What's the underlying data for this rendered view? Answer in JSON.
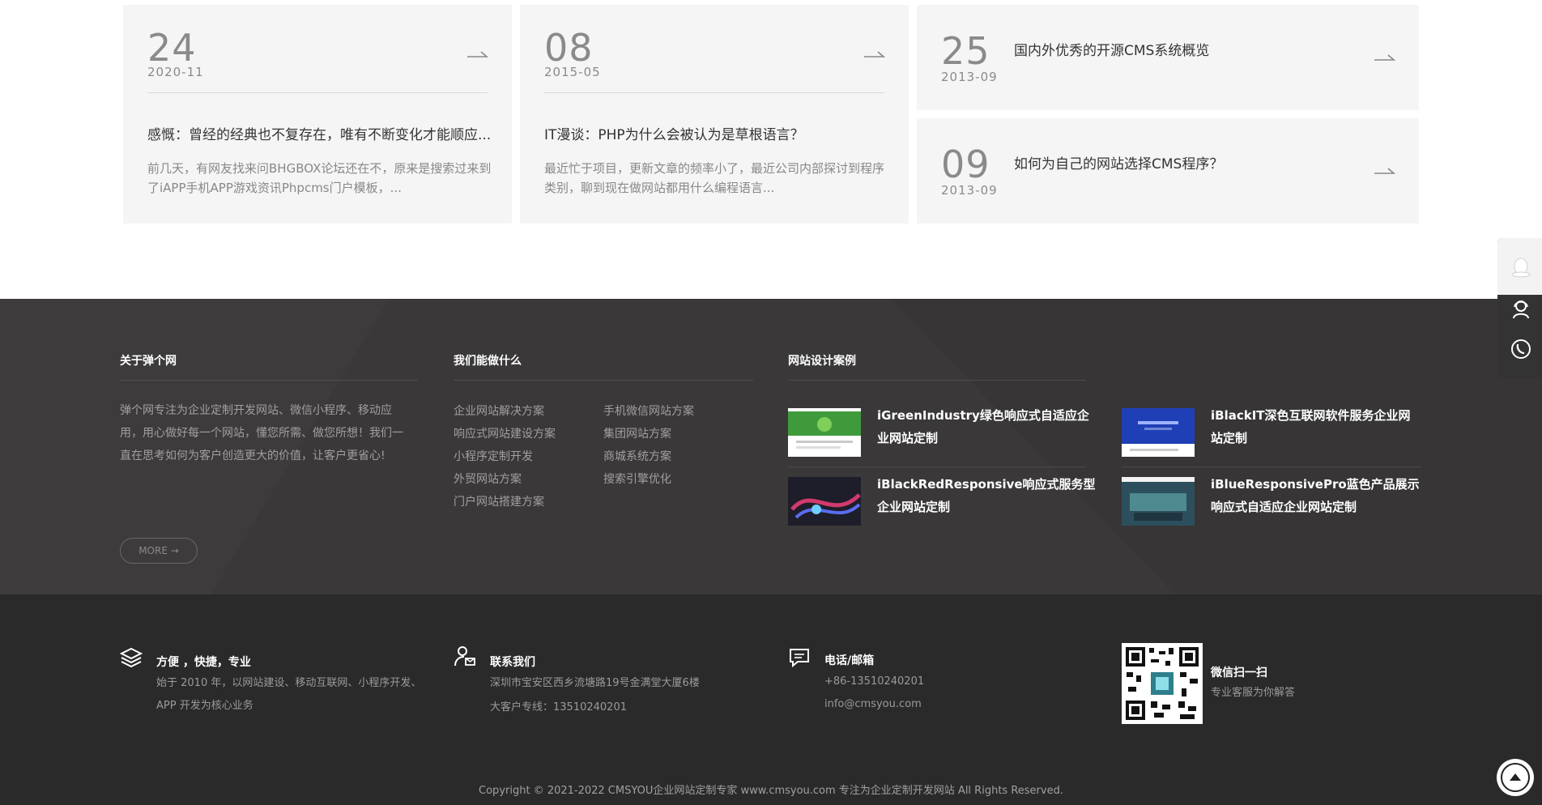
{
  "news": {
    "cards": [
      {
        "day": "24",
        "ym": "2020-11",
        "title": "感慨：曾经的经典也不复存在，唯有不断变化才能顺应...",
        "desc": "前几天，有网友找来问BHGBOX论坛还在不，原来是搜索过来到了iAPP手机APP游戏资讯Phpcms门户模板，..."
      },
      {
        "day": "08",
        "ym": "2015-05",
        "title": "IT漫谈：PHP为什么会被认为是草根语言？",
        "desc": "最近忙于项目，更新文章的频率小了，最近公司内部探讨到程序类别，聊到现在做网站都用什么编程语言..."
      }
    ],
    "side_items": [
      {
        "day": "25",
        "ym": "2013-09",
        "title": "国内外优秀的开源CMS系统概览"
      },
      {
        "day": "09",
        "ym": "2013-09",
        "title": "如何为自己的网站选择CMS程序？"
      }
    ]
  },
  "footer": {
    "about": {
      "heading": "关于弹个网",
      "text": "弹个网专注为企业定制开发网站、微信小程序、移动应用，用心做好每一个网站，懂您所需、做您所想！我们一直在思考如何为客户创造更大的价值，让客户更省心!",
      "more": "MORE →"
    },
    "services": {
      "heading": "我们能做什么",
      "col1": [
        "企业网站解决方案",
        "响应式网站建设方案",
        "小程序定制开发",
        "外贸网站方案",
        "门户网站搭建方案"
      ],
      "col2": [
        "手机微信网站方案",
        "集团网站方案",
        "商城系统方案",
        "搜索引擎优化"
      ]
    },
    "cases": {
      "heading": "网站设计案例",
      "items": [
        {
          "title": "iGreenIndustry绿色响应式自适应企业网站定制"
        },
        {
          "title": "iBlackIT深色互联网软件服务企业网站定制"
        },
        {
          "title": "iBlackRedResponsive响应式服务型企业网站定制"
        },
        {
          "title": "iBlueResponsivePro蓝色产品展示响应式自适应企业网站定制"
        }
      ]
    },
    "features": {
      "title": "方便 ，快捷，专业",
      "line1": "始于 2010 年，以网站建设、移动互联网、小程序开发、",
      "line2": "APP 开发为核心业务"
    },
    "contact": {
      "title": "联系我们",
      "address": "深圳市宝安区西乡流塘路19号金满堂大厦6楼",
      "hotline": "大客户专线：13510240201"
    },
    "phone": {
      "title": "电话/邮箱",
      "phone": "+86-13510240201",
      "email": "info@cmsyou.com"
    },
    "wechat": {
      "title": "微信扫一扫",
      "subtitle": "专业客服为你解答"
    },
    "copyright": "Copyright © 2021-2022 CMSYOU企业网站定制专家 www.cmsyou.com 专注为企业定制开发网站 All Rights Reserved."
  },
  "icons": {
    "arrow": "arrow-right-icon",
    "layers": "layers-icon",
    "contact": "user-mail-icon",
    "chat": "chat-icon",
    "qq": "qq-icon",
    "support": "customer-service-icon",
    "phone": "phone-icon",
    "top": "back-to-top-icon"
  },
  "colors": {
    "card_bg": "#f5f5f5",
    "footer_top_bg": "#3a3838",
    "footer_bottom_bg": "#2b2a2a",
    "muted_text": "#a29f9f"
  }
}
